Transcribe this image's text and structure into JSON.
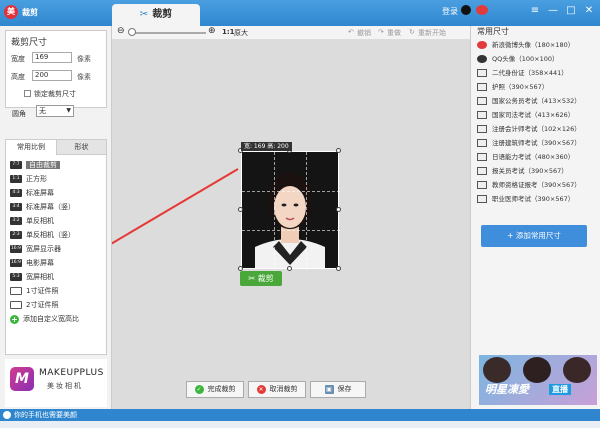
{
  "app": {
    "title": "裁剪",
    "logo_glyph": "美"
  },
  "tabs": [
    {
      "label": "裁剪",
      "icon": "scissors-icon"
    }
  ],
  "titlebar": {
    "login": "登录",
    "menu": "≡",
    "minimize": "—",
    "maximize": "□",
    "close": "✕"
  },
  "left_panel": {
    "crop_size_title": "裁剪尺寸",
    "width_label": "宽度",
    "width_value": "169",
    "width_unit": "像素",
    "height_label": "高度",
    "height_value": "200",
    "height_unit": "像素",
    "lock_label": "锁定裁剪尺寸",
    "round_label": "圆角",
    "round_value": "无",
    "tab_common": "常用比例",
    "tab_shape": "形状",
    "ratios": [
      {
        "icon": "7:7",
        "label": "自由裁剪"
      },
      {
        "icon": "1:1",
        "label": "正方形"
      },
      {
        "icon": "4:3",
        "label": "标准屏幕"
      },
      {
        "icon": "3:4",
        "label": "标准屏幕（竖）"
      },
      {
        "icon": "3:2",
        "label": "单反相机"
      },
      {
        "icon": "2:3",
        "label": "单反相机（竖）"
      },
      {
        "icon": "16:9",
        "label": "宽屏显示器"
      },
      {
        "icon": "16:9",
        "label": "电影屏幕"
      },
      {
        "icon": "5:3",
        "label": "宽屏相机"
      },
      {
        "icon": "",
        "label": "1寸证件照"
      },
      {
        "icon": "",
        "label": "2寸证件照"
      }
    ],
    "add_ratio_label": "添加自定义宽高比"
  },
  "logo": {
    "glyph": "M",
    "line1": "MAKEUPPLUS",
    "line2": "美妆相机"
  },
  "toolbar": {
    "ratio": "1:1",
    "original": "原大",
    "undo": "撤销",
    "redo": "重做",
    "reset": "重新开始"
  },
  "canvas": {
    "size_badge": "宽: 169 高: 200",
    "crop_button": "裁剪"
  },
  "bottom_buttons": {
    "done": "完成裁剪",
    "cancel": "取消裁剪",
    "save": "保存"
  },
  "right_panel": {
    "title": "常用尺寸",
    "sizes": [
      {
        "icon": "round",
        "label": "新浪微博头像（180×180）"
      },
      {
        "icon": "round",
        "label": "QQ头像（100×100）"
      },
      {
        "icon": "box",
        "label": "二代身份证（358×441）"
      },
      {
        "icon": "box",
        "label": "护照（390×567）"
      },
      {
        "icon": "box",
        "label": "国家公务员考试（413×532）"
      },
      {
        "icon": "box",
        "label": "国家司法考试（413×626）"
      },
      {
        "icon": "box",
        "label": "注册会计师考试（102×126）"
      },
      {
        "icon": "box",
        "label": "注册建筑师考试（390×567）"
      },
      {
        "icon": "box",
        "label": "日语能力考试（480×360）"
      },
      {
        "icon": "box",
        "label": "报关员考试（390×567）"
      },
      {
        "icon": "box",
        "label": "教师资格证报考（390×567）"
      },
      {
        "icon": "box",
        "label": "职业医师考试（390×567）"
      }
    ],
    "add_button": "添加常用尺寸",
    "ad_text": "明星凍愛",
    "ad_live": "直播"
  },
  "statusbar": {
    "text": "你的手机也需要美颜"
  },
  "colors": {
    "titlebar": "#2f86cf",
    "accent_green": "#4aa83a",
    "add_blue": "#3e8edb",
    "selected_gray": "#777777"
  }
}
